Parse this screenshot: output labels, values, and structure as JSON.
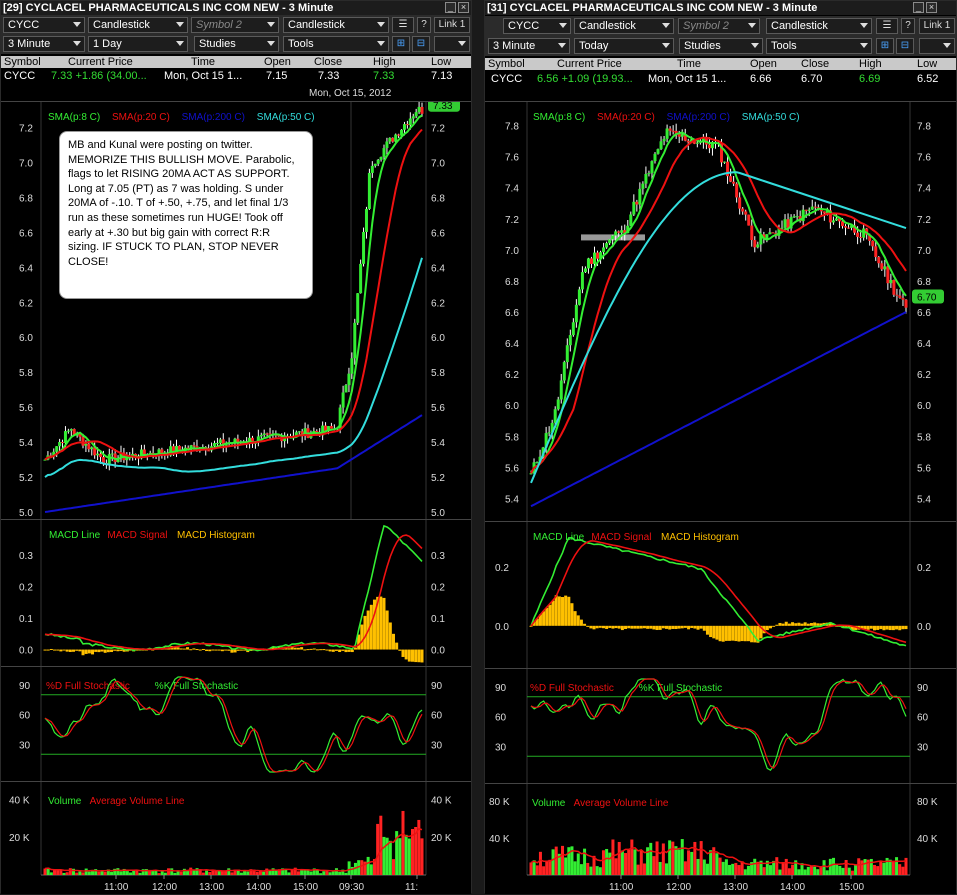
{
  "left": {
    "title": "[29] CYCLACEL PHARMACEUTICALS INC COM NEW - 3 Minute",
    "toolbar1": {
      "symbol": "CYCC",
      "chart_type": "Candlestick",
      "symbol2_placeholder": "Symbol 2",
      "chart_type2": "Candlestick",
      "help": "?",
      "link": "Link 1"
    },
    "toolbar2": {
      "interval": "3 Minute",
      "range": "1 Day",
      "studies": "Studies",
      "tools": "Tools"
    },
    "quote_headers": [
      "Symbol",
      "Current Price",
      "Time",
      "Open",
      "Close",
      "High",
      "Low"
    ],
    "quote": {
      "symbol": "CYCC",
      "price": "7.33 +1.86 (34.00...",
      "time": "Mon, Oct 15  1...",
      "open": "7.15",
      "close": "7.33",
      "high": "7.33",
      "low": "7.13"
    },
    "date_label": "Mon, Oct 15, 2012",
    "legend": {
      "sma8": "SMA(p:8 C)",
      "sma20": "SMA(p:20 C)",
      "sma200": "SMA(p:200 C)",
      "sma50": "SMA(p:50 C)"
    },
    "last_price_tag": "7.33",
    "note": "MB and Kunal were posting on twitter. MEMORIZE THIS BULLISH MOVE. Parabolic, flags to let RISING 20MA ACT AS SUPPORT.  Long at 7.05 (PT) as 7 was holding.  S under 20MA of -.10.  T of +.50, +.75, and let final 1/3 run as these sometimes run HUGE! Took off early at +.30 but big gain with correct R:R sizing. IF STUCK TO PLAN, STOP NEVER CLOSE!",
    "price_ticks": [
      "7.2",
      "7.0",
      "6.8",
      "6.6",
      "6.4",
      "6.2",
      "6.0",
      "5.8",
      "5.6",
      "5.4",
      "5.2",
      "5.0"
    ],
    "macd_legend": {
      "line": "MACD Line",
      "signal": "MACD Signal",
      "hist": "MACD Histogram"
    },
    "macd_ticks": [
      "0.3",
      "0.2",
      "0.1",
      "0.0"
    ],
    "stoch_legend": {
      "d": "%D Full Stochastic",
      "k": "%K Full Stochastic"
    },
    "stoch_ticks": [
      "90",
      "60",
      "30"
    ],
    "vol_legend": {
      "vol": "Volume",
      "avg": "Average Volume Line"
    },
    "vol_ticks": [
      "40 K",
      "20 K"
    ],
    "time_ticks": [
      "11:00",
      "12:00",
      "13:00",
      "14:00",
      "15:00",
      "09:30",
      "11:"
    ]
  },
  "right": {
    "title": "[31] CYCLACEL PHARMACEUTICALS INC COM NEW - 3 Minute",
    "toolbar1": {
      "symbol": "CYCC",
      "chart_type": "Candlestick",
      "symbol2_placeholder": "Symbol 2",
      "chart_type2": "Candlestick",
      "help": "?",
      "link": "Link 1"
    },
    "toolbar2": {
      "interval": "3 Minute",
      "range": "Today",
      "studies": "Studies",
      "tools": "Tools"
    },
    "quote_headers": [
      "Symbol",
      "Current Price",
      "Time",
      "Open",
      "Close",
      "High",
      "Low"
    ],
    "quote": {
      "symbol": "CYCC",
      "price": "6.56 +1.09 (19.93...",
      "time": "Mon, Oct 15  1...",
      "open": "6.66",
      "close": "6.70",
      "high": "6.69",
      "low": "6.52"
    },
    "legend": {
      "sma8": "SMA(p:8 C)",
      "sma20": "SMA(p:20 C)",
      "sma200": "SMA(p:200 C)",
      "sma50": "SMA(p:50 C)"
    },
    "last_price_tag": "6.70",
    "price_ticks": [
      "7.8",
      "7.6",
      "7.4",
      "7.2",
      "7.0",
      "6.8",
      "6.6",
      "6.4",
      "6.2",
      "6.0",
      "5.8",
      "5.6",
      "5.4"
    ],
    "macd_legend": {
      "line": "MACD Line",
      "signal": "MACD Signal",
      "hist": "MACD Histogram"
    },
    "macd_ticks": [
      "0.2",
      "0.0"
    ],
    "stoch_legend": {
      "d": "%D Full Stochastic",
      "k": "%K Full Stochastic"
    },
    "stoch_ticks": [
      "90",
      "60",
      "30"
    ],
    "vol_legend": {
      "vol": "Volume",
      "avg": "Average Volume Line"
    },
    "vol_ticks": [
      "80 K",
      "40 K"
    ],
    "time_ticks": [
      "11:00",
      "12:00",
      "13:00",
      "14:00",
      "15:00"
    ]
  },
  "colors": {
    "up": "#33ee33",
    "down": "#ff2222",
    "sma8": "#33ee33",
    "sma20": "#ee1111",
    "sma200": "#1111cc",
    "sma50": "#33dddd",
    "hist": "#ffc000",
    "ref": "#22aa22"
  }
}
